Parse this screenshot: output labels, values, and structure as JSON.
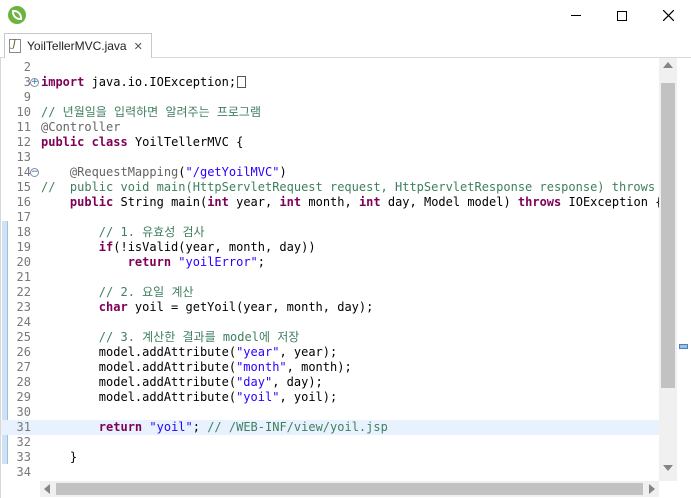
{
  "window": {
    "icon": "spring-leaf-icon",
    "controls": [
      "minimize-icon",
      "maximize-icon",
      "close-icon"
    ]
  },
  "tab": {
    "label": "YoilTellerMVC.java",
    "close_glyph": "✕",
    "icon": "java-file-icon"
  },
  "editor": {
    "current_line": 31,
    "lines": [
      {
        "n": "2",
        "code": ""
      },
      {
        "n": "3",
        "code": "<span class=\"kw\">import</span> java.io.IOException;<span class=\"fold-box\"></span>"
      },
      {
        "n": "9",
        "code": ""
      },
      {
        "n": "10",
        "code": "<span class=\"cm\">// 년월일을 입력하면 알려주는 프로그램</span>"
      },
      {
        "n": "11",
        "code": "<span class=\"ann\">@Controller</span>"
      },
      {
        "n": "12",
        "code": "<span class=\"kw\">public</span> <span class=\"kw\">class</span> YoilTellerMVC {"
      },
      {
        "n": "13",
        "code": ""
      },
      {
        "n": "14",
        "code": "    <span class=\"ann\">@RequestMapping</span>(<span class=\"str\">\"/getYoilMVC\"</span>)"
      },
      {
        "n": "15",
        "code": "<span class=\"cm\">//  public void main(HttpServletRequest request, HttpServletResponse response) throws IOE</span>"
      },
      {
        "n": "16",
        "code": "    <span class=\"kw\">public</span> String main(<span class=\"kw\">int</span> year, <span class=\"kw\">int</span> month, <span class=\"kw\">int</span> day, Model model) <span class=\"kw\">throws</span> IOException {"
      },
      {
        "n": "17",
        "code": ""
      },
      {
        "n": "18",
        "code": "        <span class=\"cm\">// 1. 유효성 검사</span>"
      },
      {
        "n": "19",
        "code": "        <span class=\"kw\">if</span>(!isValid(year, month, day))"
      },
      {
        "n": "20",
        "code": "            <span class=\"kw\">return</span> <span class=\"str\">\"yoilError\"</span>;"
      },
      {
        "n": "21",
        "code": ""
      },
      {
        "n": "22",
        "code": "        <span class=\"cm\">// 2. 요일 계산</span>"
      },
      {
        "n": "23",
        "code": "        <span class=\"kw\">char</span> yoil = getYoil(year, month, day);"
      },
      {
        "n": "24",
        "code": ""
      },
      {
        "n": "25",
        "code": "        <span class=\"cm\">// 3. 계산한 결과를 model에 저장</span>"
      },
      {
        "n": "26",
        "code": "        model.addAttribute(<span class=\"str\">\"year\"</span>, year);"
      },
      {
        "n": "27",
        "code": "        model.addAttribute(<span class=\"str\">\"month\"</span>, month);"
      },
      {
        "n": "28",
        "code": "        model.addAttribute(<span class=\"str\">\"day\"</span>, day);"
      },
      {
        "n": "29",
        "code": "        model.addAttribute(<span class=\"str\">\"yoil\"</span>, yoil);"
      },
      {
        "n": "30",
        "code": ""
      },
      {
        "n": "31",
        "code": "        <span class=\"kw\">return</span> <span class=\"str\">\"yoil\"</span>; <span class=\"cm\">// /WEB-INF/view/yoil.jsp</span>"
      },
      {
        "n": "32",
        "code": ""
      },
      {
        "n": "33",
        "code": "    }"
      },
      {
        "n": "34",
        "code": ""
      }
    ],
    "folds": {
      "3": "+",
      "14": "−"
    }
  }
}
